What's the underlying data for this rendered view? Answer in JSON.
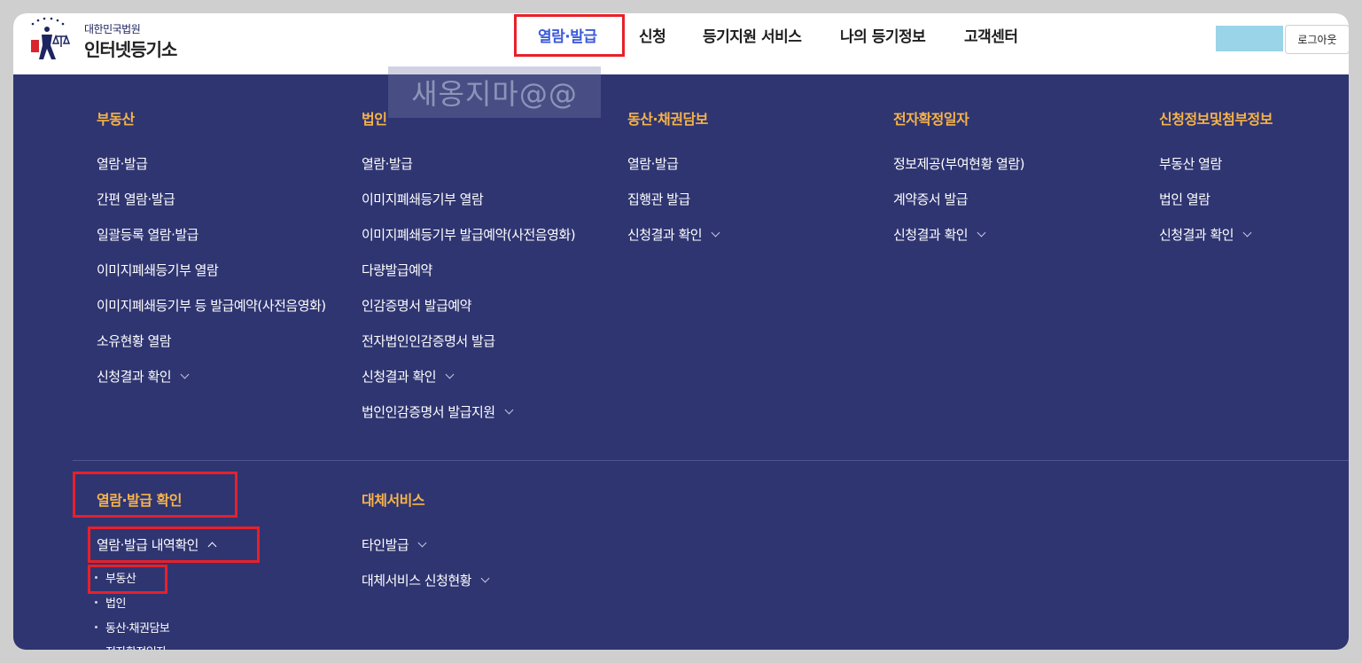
{
  "header": {
    "logo_sub": "대한민국법원",
    "logo_main": "인터넷등기소",
    "nav": [
      "열람·발급",
      "신청",
      "등기지원 서비스",
      "나의 등기정보",
      "고객센터"
    ],
    "logout_label": "로그아웃"
  },
  "watermark": "새옹지마@@",
  "columns": [
    {
      "title": "부동산",
      "items": [
        {
          "label": "열람·발급",
          "chevron": false
        },
        {
          "label": "간편 열람·발급",
          "chevron": false
        },
        {
          "label": "일괄등록 열람·발급",
          "chevron": false
        },
        {
          "label": "이미지폐쇄등기부 열람",
          "chevron": false
        },
        {
          "label": "이미지폐쇄등기부 등 발급예약(사전음영화)",
          "chevron": false
        },
        {
          "label": "소유현황 열람",
          "chevron": false
        },
        {
          "label": "신청결과 확인",
          "chevron": true
        }
      ]
    },
    {
      "title": "법인",
      "items": [
        {
          "label": "열람·발급",
          "chevron": false
        },
        {
          "label": "이미지폐쇄등기부 열람",
          "chevron": false
        },
        {
          "label": "이미지폐쇄등기부 발급예약(사전음영화)",
          "chevron": false
        },
        {
          "label": "다량발급예약",
          "chevron": false
        },
        {
          "label": "인감증명서 발급예약",
          "chevron": false
        },
        {
          "label": "전자법인인감증명서 발급",
          "chevron": false
        },
        {
          "label": "신청결과 확인",
          "chevron": true
        },
        {
          "label": "법인인감증명서 발급지원",
          "chevron": true
        }
      ]
    },
    {
      "title": "동산·채권담보",
      "items": [
        {
          "label": "열람·발급",
          "chevron": false
        },
        {
          "label": "집행관 발급",
          "chevron": false
        },
        {
          "label": "신청결과 확인",
          "chevron": true
        }
      ]
    },
    {
      "title": "전자확정일자",
      "items": [
        {
          "label": "정보제공(부여현황 열람)",
          "chevron": false
        },
        {
          "label": "계약증서 발급",
          "chevron": false
        },
        {
          "label": "신청결과 확인",
          "chevron": true
        }
      ]
    },
    {
      "title": "신청정보및첨부정보",
      "items": [
        {
          "label": "부동산 열람",
          "chevron": false
        },
        {
          "label": "법인 열람",
          "chevron": false
        },
        {
          "label": "신청결과 확인",
          "chevron": true
        }
      ]
    }
  ],
  "bottom": {
    "check": {
      "title": "열람·발급 확인",
      "expanded_label": "열람·발급 내역확인",
      "sub_items": [
        "부동산",
        "법인",
        "동산·채권담보",
        "전자확정일자"
      ]
    },
    "alt": {
      "title": "대체서비스",
      "items": [
        {
          "label": "타인발급",
          "chevron": true
        },
        {
          "label": "대체서비스 신청현황",
          "chevron": true
        }
      ]
    }
  },
  "colors": {
    "panel_bg": "#2f3571",
    "accent_title": "#f6b349",
    "nav_active": "#3e5bd9",
    "highlight_box": "#e8202a"
  }
}
